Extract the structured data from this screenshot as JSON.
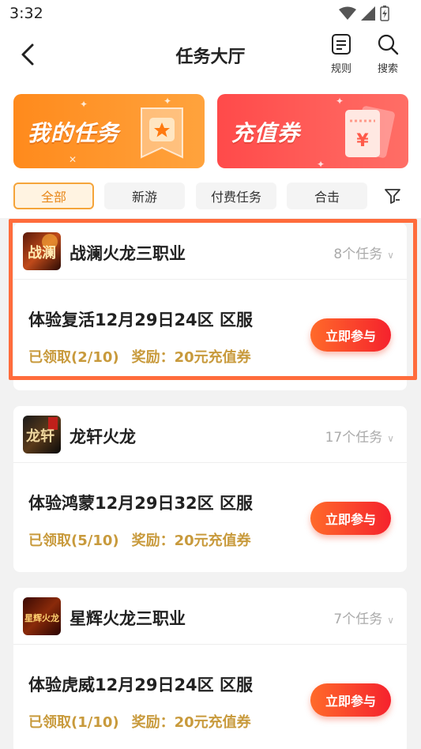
{
  "status_bar": {
    "time": "3:32"
  },
  "header": {
    "title": "任务大厅",
    "rules_label": "规则",
    "search_label": "搜索"
  },
  "banners": [
    {
      "label": "我的任务",
      "color": "#ff8a1c"
    },
    {
      "label": "充值券",
      "color": "#ff4a4a"
    }
  ],
  "filters": {
    "tabs": [
      "全部",
      "新游",
      "付费任务",
      "合击"
    ],
    "active": "全部"
  },
  "cards": [
    {
      "game": "战澜火龙三职业",
      "task_count": "8个任务",
      "task_title": "体验复活12月29日24区 区服",
      "claimed": "已领取(2/10)",
      "reward": "奖励：20元充值券",
      "button": "立即参与",
      "logo_text": "战澜"
    },
    {
      "game": "龙轩火龙",
      "task_count": "17个任务",
      "task_title": "体验鸿蒙12月29日32区 区服",
      "claimed": "已领取(5/10)",
      "reward": "奖励：20元充值券",
      "button": "立即参与",
      "logo_text": "龙轩"
    },
    {
      "game": "星辉火龙三职业",
      "task_count": "7个任务",
      "task_title": "体验虎威12月29日24区 区服",
      "claimed": "已领取(1/10)",
      "reward": "奖励：20元充值券",
      "button": "立即参与",
      "logo_text": "星辉火龙"
    }
  ],
  "colors": {
    "accent": "#ff6c3c",
    "gold_text": "#c89a3c",
    "button_gradient_start": "#ff6a2a",
    "button_gradient_end": "#f5222d"
  }
}
